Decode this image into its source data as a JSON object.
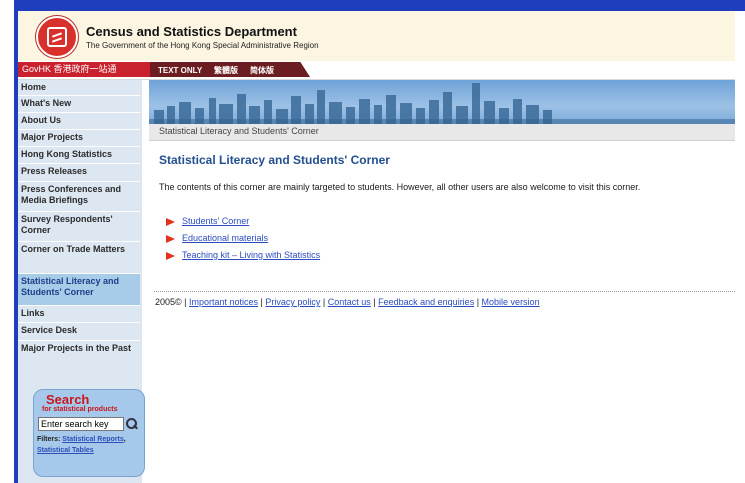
{
  "header": {
    "title": "Census and Statistics Department",
    "subtitle": "The Government of the Hong Kong Special Administrative Region"
  },
  "topbar": {
    "govhk": "GovHK 香港政府一站通",
    "text_only": "TEXT ONLY",
    "trad_chinese": "繁體版",
    "simp_chinese": "简体版"
  },
  "sidebar": {
    "items": [
      {
        "label": "Home",
        "active": false
      },
      {
        "label": "What's New",
        "active": false
      },
      {
        "label": "About Us",
        "active": false
      },
      {
        "label": "Major Projects",
        "active": false
      },
      {
        "label": "Hong Kong Statistics",
        "active": false
      },
      {
        "label": "Press Releases",
        "active": false
      },
      {
        "label": "Press Conferences and Media Briefings",
        "active": false
      },
      {
        "label": "Survey Respondents' Corner",
        "active": false
      },
      {
        "label": "Corner on Trade Matters",
        "active": false
      },
      {
        "label": "Statistical Literacy and Students' Corner",
        "active": true
      },
      {
        "label": "Links",
        "active": false
      },
      {
        "label": "Service Desk",
        "active": false
      },
      {
        "label": "Major Projects in the Past",
        "active": false
      }
    ]
  },
  "search": {
    "title": "Search",
    "subtitle": "for statistical products",
    "input_value": "Enter search key",
    "filters_label": "Filters:",
    "filter_1": "Statistical Reports",
    "filter_2": "Statistical Tables"
  },
  "breadcrumb": "Statistical Literacy and Students' Corner",
  "main": {
    "title": "Statistical Literacy and Students' Corner",
    "intro": "The contents of this corner are mainly targeted to students. However, all other users are also welcome to visit this corner.",
    "links": [
      "Students' Corner",
      "Educational materials",
      "Teaching kit – Living with Statistics"
    ]
  },
  "footer": {
    "copyright": "2005©",
    "links": [
      "Important notices",
      "Privacy policy",
      "Contact us",
      "Feedback and enquiries",
      "Mobile version"
    ]
  },
  "colors": {
    "frame_blue": "#1f3ebd",
    "govhk_red": "#c9212d",
    "sidebar_bg": "#dce7f2",
    "active_item": "#a8cbe8",
    "title_blue": "#234f8f",
    "link_blue": "#2a4cbf"
  }
}
